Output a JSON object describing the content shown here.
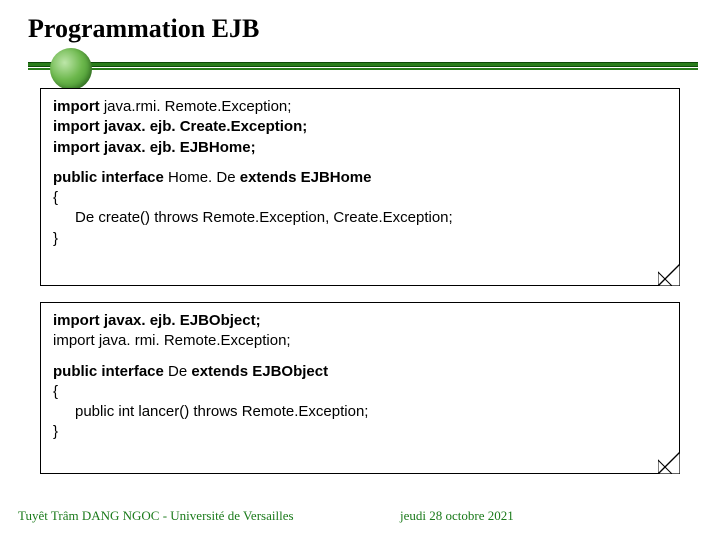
{
  "title": "Programmation EJB",
  "box1": {
    "l1_pre": "import ",
    "l1_txt": "java.rmi. Remote.Exception;",
    "l2": "import javax. ejb. Create.Exception;",
    "l3": "import javax. ejb. EJBHome;",
    "l4a": "public interface ",
    "l4b": "Home. De ",
    "l4c": "extends EJBHome",
    "l5": "{",
    "l6": "De create() throws Remote.Exception, Create.Exception;",
    "l7": "}"
  },
  "box2": {
    "l1a": "import",
    "l1b": " javax. ejb. EJBObject;",
    "l2": "import java. rmi. Remote.Exception;",
    "l3a": "public interface ",
    "l3b": "De ",
    "l3c": "extends EJBObject",
    "l4": "{",
    "l5": "public int lancer() throws Remote.Exception;",
    "l6": "}"
  },
  "footer": {
    "left": "Tuyêt Trâm DANG NGOC - Université de Versailles",
    "right": "jeudi 28 octobre 2021"
  }
}
